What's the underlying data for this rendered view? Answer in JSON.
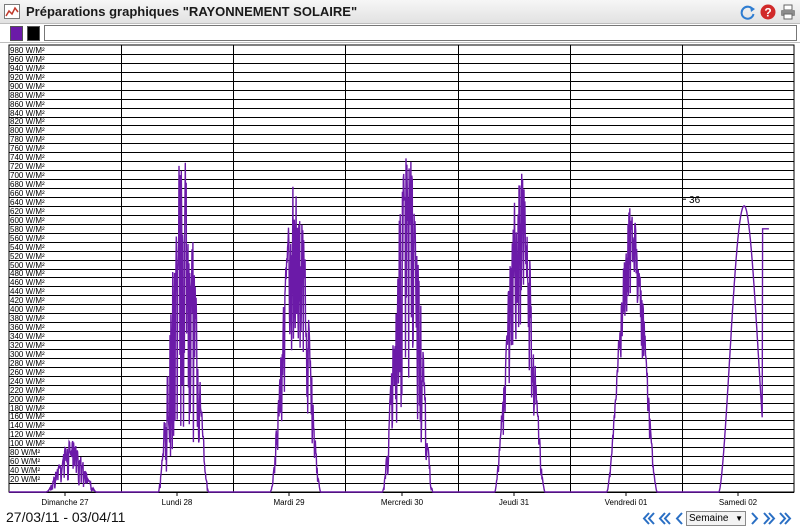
{
  "window": {
    "title": "Préparations graphiques \"RAYONNEMENT SOLAIRE\"",
    "icons": [
      "chart-icon",
      "refresh-icon",
      "help-icon",
      "print-icon"
    ]
  },
  "legend": {
    "swatches": [
      {
        "name": "legend-swatch-purple",
        "color": "#6b1aa8"
      },
      {
        "name": "legend-swatch-black",
        "color": "#000000"
      }
    ]
  },
  "footer": {
    "date_range": "27/03/11 - 03/04/11",
    "period": "Semaine",
    "nav_icons": [
      "first-icon",
      "prev-fast-icon",
      "prev-icon",
      "next-icon",
      "next-fast-icon",
      "last-icon"
    ]
  },
  "chart_data": {
    "type": "line",
    "title": "",
    "y_unit": "W/M²",
    "ylim": [
      0,
      1000
    ],
    "y_ticks": [
      20,
      40,
      60,
      80,
      100,
      120,
      140,
      160,
      180,
      200,
      220,
      240,
      260,
      280,
      300,
      320,
      340,
      360,
      380,
      400,
      420,
      440,
      460,
      480,
      500,
      520,
      540,
      560,
      580,
      600,
      620,
      640,
      660,
      680,
      700,
      720,
      740,
      760,
      780,
      800,
      820,
      840,
      860,
      880,
      900,
      920,
      940,
      960,
      980
    ],
    "x_days": [
      "Dimanche 27",
      "Lundi 28",
      "Mardi 29",
      "Mercredi 30",
      "Jeudi 31",
      "Vendredi 01",
      "Samedi 02"
    ],
    "grid": true,
    "annotation": "36",
    "series": [
      {
        "color": "#6b1aa8",
        "days": [
          {
            "day": "Dimanche 27",
            "peak": 115,
            "noise": 0.85
          },
          {
            "day": "Lundi 28",
            "peak": 775,
            "noise": 0.85
          },
          {
            "day": "Mardi 29",
            "peak": 715,
            "noise": 0.6
          },
          {
            "day": "Mercredi 30",
            "peak": 765,
            "noise": 0.75
          },
          {
            "day": "Jeudi 31",
            "peak": 720,
            "noise": 0.55
          },
          {
            "day": "Vendredi 01",
            "peak": 645,
            "noise": 0.35
          },
          {
            "day": "Samedi 02",
            "peak": 640,
            "noise": 0.05,
            "partial": true
          }
        ]
      }
    ]
  }
}
